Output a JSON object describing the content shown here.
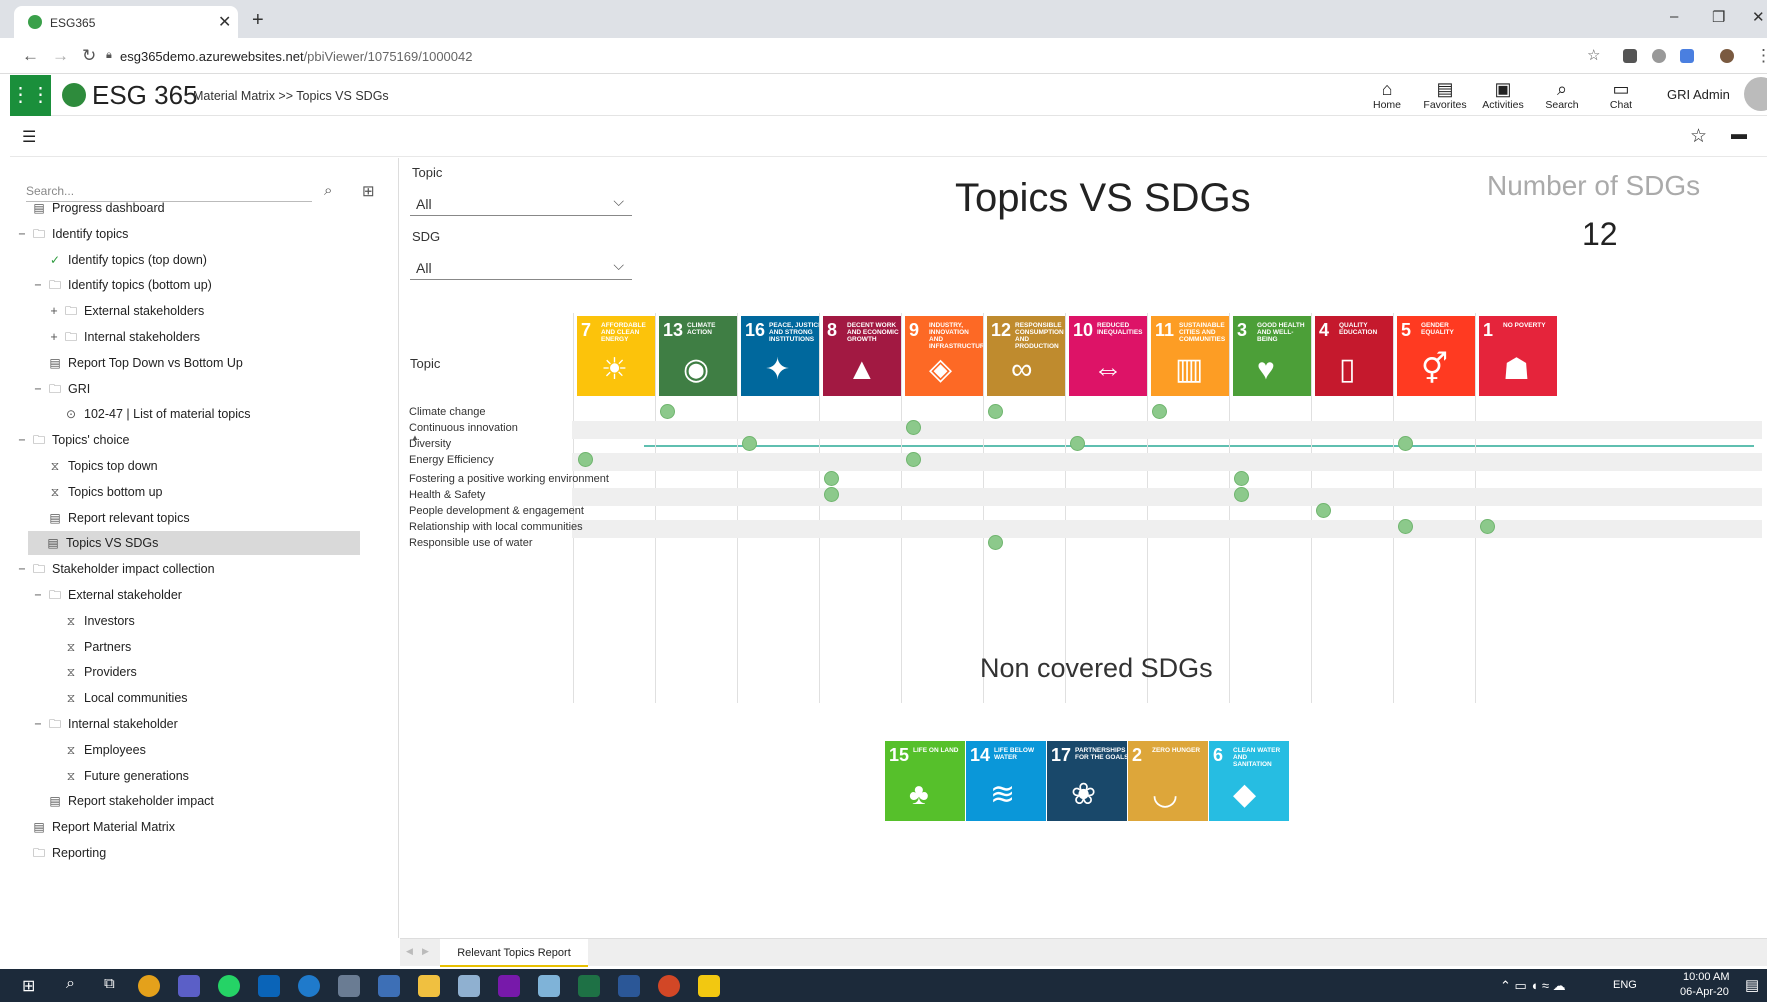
{
  "browser": {
    "tab_title": "ESG365",
    "url_host": "esg365demo.azurewebsites.net",
    "url_path": "/pbiViewer/1075169/1000042"
  },
  "app": {
    "logo_text": "ESG 365",
    "breadcrumb": "Material Matrix >> Topics VS SDGs",
    "nav": [
      {
        "label": "Home",
        "icon": "home-icon"
      },
      {
        "label": "Favorites",
        "icon": "favorites-icon"
      },
      {
        "label": "Activities",
        "icon": "activities-icon"
      },
      {
        "label": "Search",
        "icon": "search-icon"
      },
      {
        "label": "Chat",
        "icon": "chat-icon"
      }
    ],
    "user": "GRI Admin"
  },
  "sidebar": {
    "search_placeholder": "Search...",
    "items": [
      {
        "label": "Progress dashboard",
        "icon": "report-icon"
      },
      {
        "label": "Identify topics",
        "icon": "folder-icon",
        "toggle": "−"
      },
      {
        "label": "Identify topics (top down)",
        "icon": "check-icon"
      },
      {
        "label": "Identify topics (bottom up)",
        "icon": "folder-icon",
        "toggle": "−"
      },
      {
        "label": "External stakeholders",
        "icon": "folder-icon",
        "toggle": "+"
      },
      {
        "label": "Internal stakeholders",
        "icon": "folder-icon",
        "toggle": "+"
      },
      {
        "label": "Report Top Down vs Bottom Up",
        "icon": "report-icon"
      },
      {
        "label": "GRI",
        "icon": "folder-icon",
        "toggle": "−"
      },
      {
        "label": "102-47 | List of material topics",
        "icon": "play-icon"
      },
      {
        "label": "Topics' choice",
        "icon": "folder-icon",
        "toggle": "−"
      },
      {
        "label": "Topics top down",
        "icon": "hourglass-icon"
      },
      {
        "label": "Topics bottom up",
        "icon": "hourglass-icon"
      },
      {
        "label": "Report relevant topics",
        "icon": "report-icon"
      },
      {
        "label": "Topics VS SDGs",
        "icon": "report-icon"
      },
      {
        "label": "Stakeholder impact collection",
        "icon": "folder-icon",
        "toggle": "−"
      },
      {
        "label": "External stakeholder",
        "icon": "folder-icon",
        "toggle": "−"
      },
      {
        "label": "Investors",
        "icon": "hourglass-icon"
      },
      {
        "label": "Partners",
        "icon": "hourglass-icon"
      },
      {
        "label": "Providers",
        "icon": "hourglass-icon"
      },
      {
        "label": "Local communities",
        "icon": "hourglass-icon"
      },
      {
        "label": "Internal stakeholder",
        "icon": "folder-icon",
        "toggle": "−"
      },
      {
        "label": "Employees",
        "icon": "hourglass-icon"
      },
      {
        "label": "Future generations",
        "icon": "hourglass-icon"
      },
      {
        "label": "Report stakeholder impact",
        "icon": "report-icon"
      },
      {
        "label": "Report Material Matrix",
        "icon": "report-icon"
      },
      {
        "label": "Reporting",
        "icon": "folder-icon"
      }
    ]
  },
  "report": {
    "filter_topic_label": "Topic",
    "filter_topic_value": "All",
    "filter_sdg_label": "SDG",
    "filter_sdg_value": "All",
    "title": "Topics VS SDGs",
    "card_label": "Number of SDGs",
    "card_value": "12",
    "matrix_row_header": "Topic",
    "non_covered_title": "Non covered SDGs",
    "page_tab": "Relevant Topics Report"
  },
  "sdgs": [
    {
      "num": "7",
      "name": "Affordable and clean energy",
      "color": "#fcc30b",
      "glyph": "☀"
    },
    {
      "num": "13",
      "name": "Climate action",
      "color": "#3f7e44",
      "glyph": "◉"
    },
    {
      "num": "16",
      "name": "Peace, justice and strong institutions",
      "color": "#00689d",
      "glyph": "✦"
    },
    {
      "num": "8",
      "name": "Decent work and economic growth",
      "color": "#a21942",
      "glyph": "▲"
    },
    {
      "num": "9",
      "name": "Industry, innovation and infrastructure",
      "color": "#fd6925",
      "glyph": "◈"
    },
    {
      "num": "12",
      "name": "Responsible consumption and production",
      "color": "#bf8b2e",
      "glyph": "∞"
    },
    {
      "num": "10",
      "name": "Reduced inequalities",
      "color": "#dd1367",
      "glyph": "⇔"
    },
    {
      "num": "11",
      "name": "Sustainable cities and communities",
      "color": "#fd9d24",
      "glyph": "▥"
    },
    {
      "num": "3",
      "name": "Good health and well-being",
      "color": "#4c9f38",
      "glyph": "♥"
    },
    {
      "num": "4",
      "name": "Quality education",
      "color": "#c5192d",
      "glyph": "▯"
    },
    {
      "num": "5",
      "name": "Gender equality",
      "color": "#ff3a21",
      "glyph": "⚥"
    },
    {
      "num": "1",
      "name": "No poverty",
      "color": "#e5243b",
      "glyph": "☗"
    }
  ],
  "topics": [
    {
      "name": "Climate change",
      "sdg_cols": [
        1,
        5,
        7
      ]
    },
    {
      "name": "Continuous innovation",
      "sdg_cols": [
        4
      ]
    },
    {
      "name": "Diversity",
      "sdg_cols": [
        2,
        6,
        10
      ]
    },
    {
      "name": "Energy Efficiency",
      "sdg_cols": [
        0,
        4
      ]
    },
    {
      "name": "Fostering a positive working environment",
      "sdg_cols": [
        3,
        8
      ]
    },
    {
      "name": "Health & Safety",
      "sdg_cols": [
        3,
        8
      ]
    },
    {
      "name": "People development & engagement",
      "sdg_cols": [
        9
      ]
    },
    {
      "name": "Relationship with local communities",
      "sdg_cols": [
        10,
        11
      ]
    },
    {
      "name": "Responsible use of water",
      "sdg_cols": [
        5
      ]
    }
  ],
  "non_covered": [
    {
      "num": "15",
      "name": "Life on land",
      "color": "#56c02b",
      "glyph": "♣"
    },
    {
      "num": "14",
      "name": "Life below water",
      "color": "#0a97d9",
      "glyph": "≋"
    },
    {
      "num": "17",
      "name": "Partnerships for the goals",
      "color": "#19486a",
      "glyph": "❀"
    },
    {
      "num": "2",
      "name": "Zero hunger",
      "color": "#dda63a",
      "glyph": "◡"
    },
    {
      "num": "6",
      "name": "Clean water and sanitation",
      "color": "#26bde2",
      "glyph": "◆"
    }
  ],
  "taskbar": {
    "lang": "ENG",
    "time": "10:00 AM",
    "date": "06-Apr-20"
  }
}
